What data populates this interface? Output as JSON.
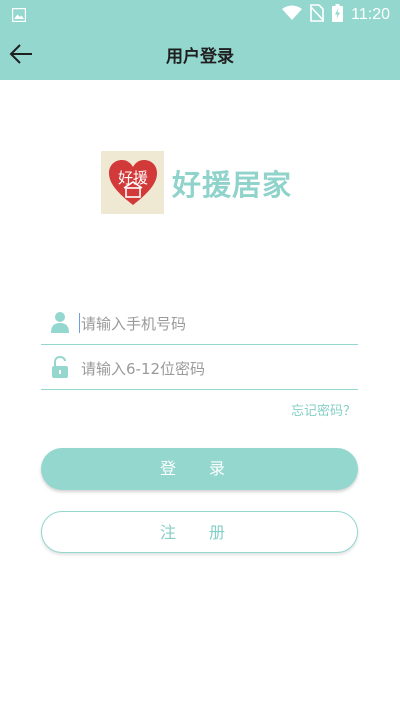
{
  "status_bar": {
    "time": "11:20"
  },
  "app_bar": {
    "title": "用户登录"
  },
  "logo": {
    "badge_text": "好援",
    "name": "好援居家"
  },
  "form": {
    "phone_placeholder": "请输入手机号码",
    "password_placeholder": "请输入6-12位密码",
    "forgot_label": "忘记密码？"
  },
  "buttons": {
    "login_label": "登 录",
    "register_label": "注 册"
  },
  "colors": {
    "accent": "#93d7cf",
    "accent_text": "#84cfc6",
    "logo_heart": "#d23a3a"
  },
  "icons": [
    "image-icon",
    "wifi-icon",
    "no-sim-icon",
    "battery-charging-icon",
    "back-arrow-icon",
    "user-icon",
    "lock-icon"
  ]
}
